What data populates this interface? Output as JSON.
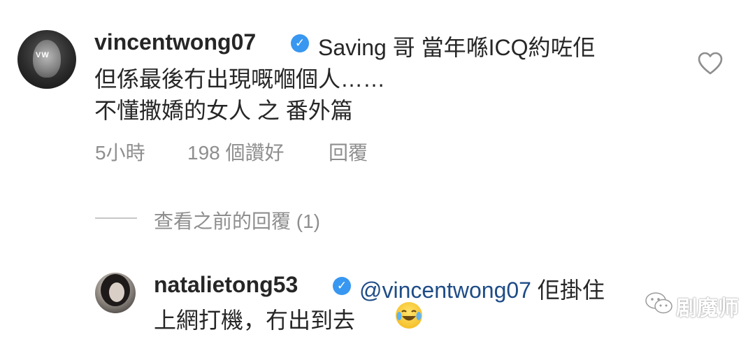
{
  "comments": [
    {
      "username": "vincentwong07",
      "verified": true,
      "text_line1": "Saving 哥 當年喺ICQ約咗佢",
      "text_line2": "但係最後冇出現嘅嗰個人……",
      "text_line3": "不懂撒嬌的女人 之 番外篇",
      "time": "5小時",
      "likes": "198 個讚好",
      "reply_label": "回覆",
      "avatar_initials": "VW"
    },
    {
      "username": "natalietong53",
      "verified": true,
      "mention": "@vincentwong07",
      "text_line1_after_mention": " 佢掛住",
      "text_line2": "上網打機，冇出到去"
    }
  ],
  "view_replies_label": "查看之前的回覆 (1)",
  "watermark": "剧魔师",
  "icons": {
    "like": "heart-outline-icon",
    "verified": "verified-badge-icon",
    "emoji": "tears-of-joy-emoji",
    "watermark_logo": "wechat-logo-icon"
  },
  "colors": {
    "verified_blue": "#3897f0",
    "mention": "#1e4c87",
    "muted": "#8e8e8e"
  }
}
